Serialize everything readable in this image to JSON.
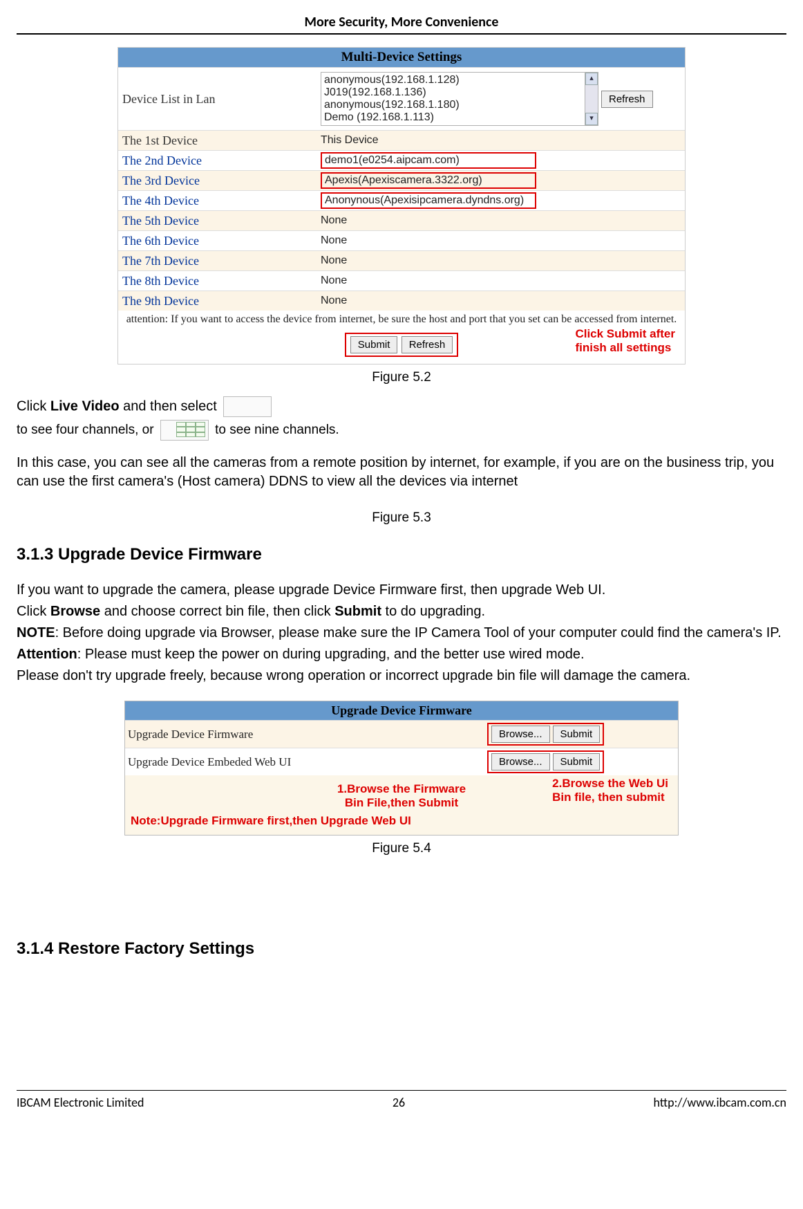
{
  "header": {
    "title": "More Security, More Convenience"
  },
  "fig52": {
    "title": "Multi-Device Settings",
    "deviceListLabel": "Device List in Lan",
    "deviceListItems": [
      "anonymous(192.168.1.128)",
      "J019(192.168.1.136)",
      "anonymous(192.168.1.180)",
      "Demo (192.168.1.113)"
    ],
    "refreshLabel": "Refresh",
    "rows": [
      {
        "label": "The 1st Device",
        "value": "This Device",
        "highlight": false,
        "labelBlack": true
      },
      {
        "label": "The 2nd Device",
        "value": "demo1(e0254.aipcam.com)",
        "highlight": true,
        "labelBlack": false
      },
      {
        "label": "The 3rd Device",
        "value": "Apexis(Apexiscamera.3322.org)",
        "highlight": true,
        "labelBlack": false
      },
      {
        "label": "The 4th Device",
        "value": "Anonynous(Apexisipcamera.dyndns.org)",
        "highlight": true,
        "labelBlack": false
      },
      {
        "label": "The 5th Device",
        "value": "None",
        "highlight": false,
        "labelBlack": false
      },
      {
        "label": "The 6th Device",
        "value": "None",
        "highlight": false,
        "labelBlack": false
      },
      {
        "label": "The 7th Device",
        "value": "None",
        "highlight": false,
        "labelBlack": false
      },
      {
        "label": "The 8th Device",
        "value": "None",
        "highlight": false,
        "labelBlack": false
      },
      {
        "label": "The 9th Device",
        "value": "None",
        "highlight": false,
        "labelBlack": false
      }
    ],
    "attention": "attention: If you want to access the device from internet, be sure the host and port that you set can be accessed from internet.",
    "submitLabel": "Submit",
    "refreshLabel2": "Refresh",
    "redNote1": "Click Submit after",
    "redNote2": "finish all settings",
    "caption": "Figure 5.2"
  },
  "para1": {
    "t1": "Click ",
    "b1": "Live Video",
    "t2": " and then select ",
    "t3": " to see four channels, or ",
    "t4": " to see nine channels.",
    "line2": "In this case, you can see all the cameras from a remote position by internet, for example, if you are on the business trip, you can use the first camera's (Host camera) DDNS to view all the devices via internet"
  },
  "fig53caption": "Figure 5.3",
  "section313": {
    "heading": "3.1.3 Upgrade Device Firmware",
    "p1": "If you want to upgrade the camera, please upgrade Device Firmware first, then upgrade Web UI.",
    "p2a": "Click ",
    "p2b1": "Browse",
    "p2c": " and choose correct bin file, then click ",
    "p2b2": "Submit",
    "p2d": " to do upgrading.",
    "p3a": "NOTE",
    "p3b": ": Before doing upgrade via Browser, please make sure the IP Camera Tool of your computer could find the camera's IP.",
    "p4a": "Attention",
    "p4b": ": Please must keep the power on during upgrading, and the better use wired mode.",
    "p5": "Please don't try upgrade freely, because wrong operation or incorrect upgrade bin file will damage the camera."
  },
  "fig54": {
    "title": "Upgrade Device Firmware",
    "row1Label": "Upgrade Device Firmware",
    "row2Label": "Upgrade Device Embeded Web UI",
    "browseLabel": "Browse...",
    "submitLabel": "Submit",
    "noteLeft1": "1.Browse  the Firmware",
    "noteLeft2": "Bin File,then Submit",
    "noteRight1": "2.Browse  the Web Ui",
    "noteRight2": "Bin file, then submit",
    "noteBottom": "Note:Upgrade Firmware first,then Upgrade Web UI",
    "caption": "Figure 5.4"
  },
  "section314": {
    "heading": "3.1.4 Restore Factory Settings"
  },
  "footer": {
    "left": "IBCAM Electronic Limited",
    "center": "26",
    "right": "http://www.ibcam.com.cn"
  }
}
